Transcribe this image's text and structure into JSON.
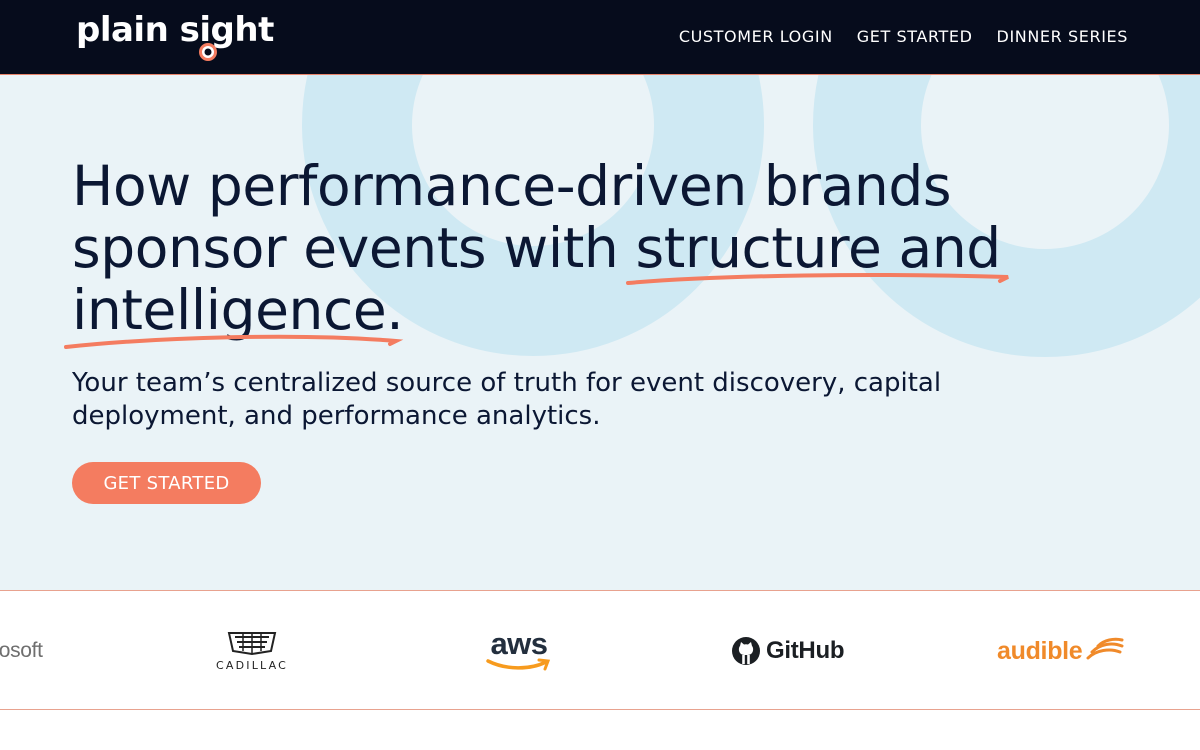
{
  "nav": {
    "logo_text": "plain sight",
    "links": [
      {
        "label": "CUSTOMER LOGIN"
      },
      {
        "label": "GET STARTED"
      },
      {
        "label": "DINNER SERIES"
      }
    ]
  },
  "hero": {
    "headline_part1": "How performance-driven brands sponsor events with ",
    "headline_highlight1": "structure and",
    "headline_highlight2": "intelligence",
    "headline_end": ".",
    "subhead": "Your team’s centralized source of truth for event discovery, capital deployment, and performance analytics.",
    "cta_label": "GET STARTED"
  },
  "brands": [
    {
      "name": "rosoft"
    },
    {
      "name": "CADILLAC"
    },
    {
      "name": "aws"
    },
    {
      "name": "GitHub"
    },
    {
      "name": "audible"
    }
  ],
  "colors": {
    "nav_bg": "#060c1c",
    "hero_bg": "#eaf3f7",
    "accent": "#f47c60",
    "deco_circle": "#cfe9f3",
    "text_dark": "#0b1733"
  }
}
